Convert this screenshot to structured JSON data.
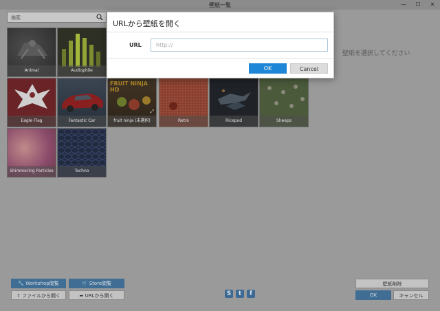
{
  "window": {
    "title": "壁紙一覧",
    "minimize": "—",
    "maximize": "☐",
    "close": "✕"
  },
  "search": {
    "placeholder": "検索",
    "icon": "search-icon"
  },
  "wallpapers": [
    {
      "name": "Animal"
    },
    {
      "name": "Audiophile"
    },
    {
      "name": "Eagle Flag"
    },
    {
      "name": "Fantastic Car"
    },
    {
      "name": "fruit ninja (未選択)"
    },
    {
      "name": "Retro"
    },
    {
      "name": "Ricepod"
    },
    {
      "name": "Sheeps"
    },
    {
      "name": "Shimmering Particles"
    },
    {
      "name": "Techno"
    }
  ],
  "thumb_banner": "FRUIT NINJA HD",
  "preview": {
    "placeholder": "壁紙を選択してください"
  },
  "bottom_left": {
    "workshop": "Workshop閲覧",
    "store": "Store閲覧",
    "from_file": "ファイルから開く",
    "from_url": "URLから開く"
  },
  "social": {
    "steam": "S",
    "twitter": "t",
    "facebook": "f"
  },
  "bottom_right": {
    "delete": "壁紙削除",
    "ok": "OK",
    "cancel": "キャンセル"
  },
  "dialog": {
    "title": "URLから壁紙を開く",
    "url_label": "URL",
    "url_placeholder": "http://",
    "ok": "OK",
    "cancel": "Cancel"
  }
}
